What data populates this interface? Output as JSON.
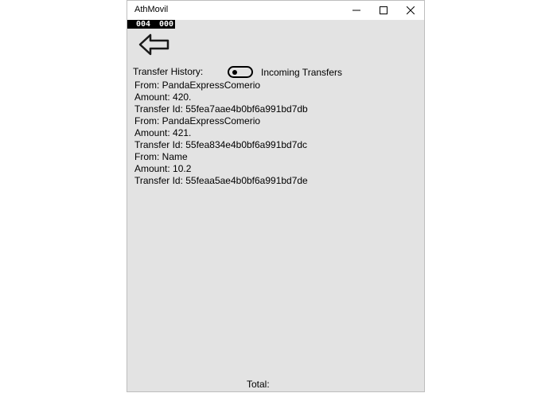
{
  "window": {
    "title": "AthMovil"
  },
  "counter": {
    "left": "004",
    "right": "000"
  },
  "history": {
    "label": "Transfer History:",
    "toggle_label": "Incoming Transfers",
    "toggle_on": false
  },
  "transfers": [
    {
      "from": "From: PandaExpressComerio",
      "amount": "Amount: 420.",
      "id": "Transfer Id: 55fea7aae4b0bf6a991bd7db"
    },
    {
      "from": "From: PandaExpressComerio",
      "amount": "Amount: 421.",
      "id": "Transfer Id: 55fea834e4b0bf6a991bd7dc"
    },
    {
      "from": "From: Name",
      "amount": "Amount: 10.2",
      "id": "Transfer Id: 55feaa5ae4b0bf6a991bd7de"
    }
  ],
  "footer": {
    "total_label": "Total:"
  }
}
